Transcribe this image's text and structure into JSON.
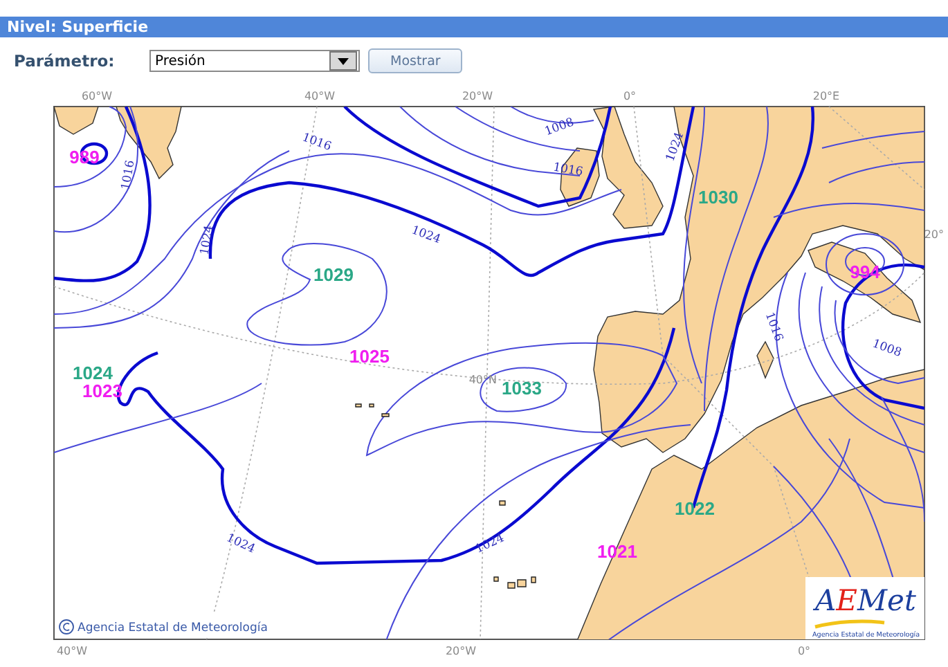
{
  "section_title": "Nivel: Superficie",
  "form": {
    "label": "Parámetro:",
    "select": {
      "value": "Presión"
    },
    "button": "Mostrar"
  },
  "map": {
    "top_axis_labels": [
      "60°W",
      "40°W",
      "20°W",
      "0°",
      "20°E"
    ],
    "bottom_axis_labels": [
      "40°W",
      "20°W",
      "0°"
    ],
    "grid_labels": [
      "40°N",
      "20°"
    ],
    "pressure_centers": [
      {
        "kind": "low",
        "value": "989"
      },
      {
        "kind": "high",
        "value": "1030"
      },
      {
        "kind": "high",
        "value": "1029"
      },
      {
        "kind": "low",
        "value": "994"
      },
      {
        "kind": "low",
        "value": "1025"
      },
      {
        "kind": "high",
        "value": "1024"
      },
      {
        "kind": "high",
        "value": "1033"
      },
      {
        "kind": "low",
        "value": "1023"
      },
      {
        "kind": "high",
        "value": "1022"
      },
      {
        "kind": "low",
        "value": "1021"
      }
    ],
    "isobar_labels": [
      "1016",
      "1008",
      "1016",
      "1024",
      "1016",
      "1024",
      "1024",
      "1016",
      "1008",
      "1024",
      "1024"
    ],
    "copyright": "Agencia Estatal de Meteorología",
    "logo": {
      "parts": [
        {
          "text": "A",
          "color": "#1c3f9e"
        },
        {
          "text": "E",
          "color": "#e32119"
        },
        {
          "text": "Met",
          "color": "#1c3f9e"
        }
      ],
      "caption": "Agencia Estatal de Meteorología"
    }
  }
}
